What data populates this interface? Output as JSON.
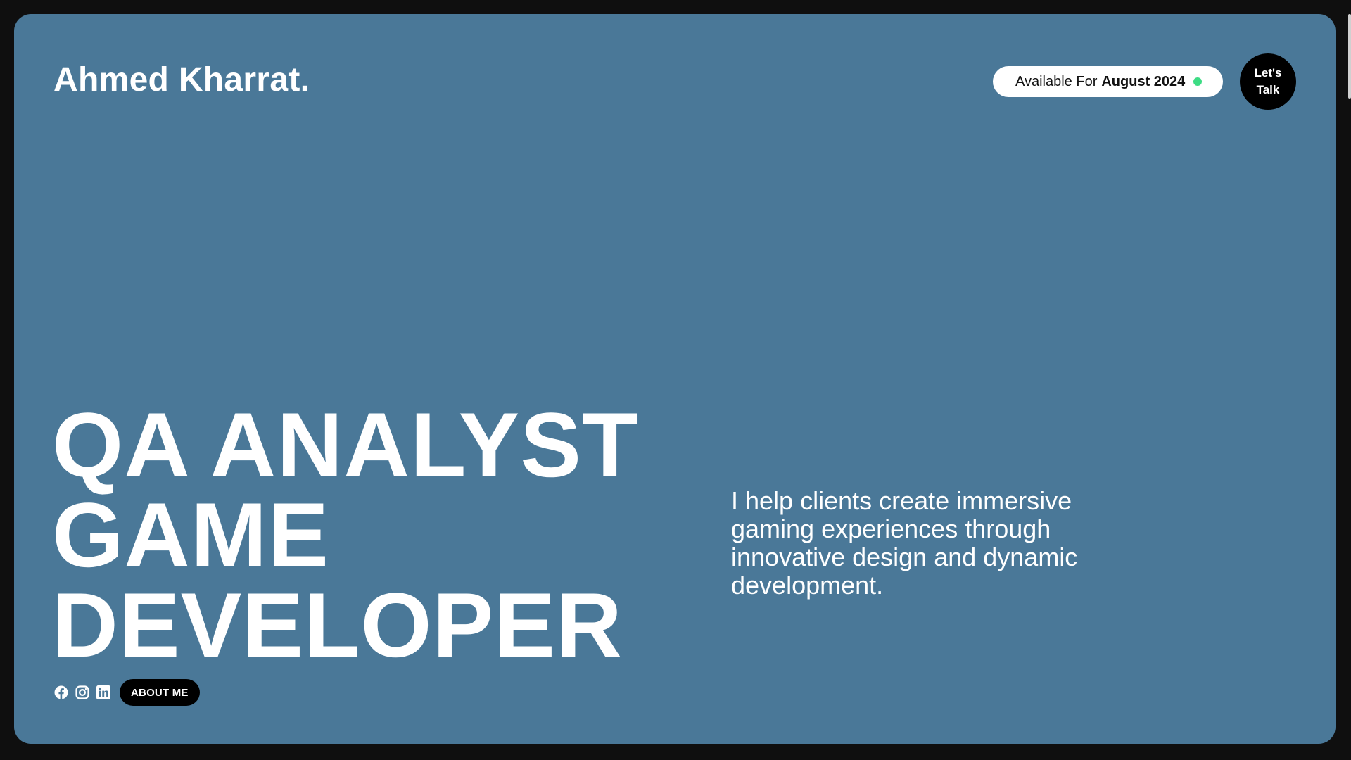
{
  "header": {
    "brand": "Ahmed Kharrat.",
    "availability": {
      "prefix": "Available For",
      "date": "August 2024",
      "status_color": "#3ddc84"
    },
    "cta": {
      "line1": "Let's",
      "line2": "Talk"
    }
  },
  "hero": {
    "headline_lines": [
      "QA ANALYST",
      "GAME",
      "DEVELOPER"
    ],
    "tagline": "I help clients create immersive gaming experiences through innovative design and dynamic development."
  },
  "footer": {
    "social_icons": [
      "facebook-icon",
      "instagram-icon",
      "linkedin-icon"
    ],
    "about_button": "ABOUT ME"
  },
  "colors": {
    "background": "#0f0f0f",
    "card": "#4a7898",
    "text": "#ffffff",
    "button": "#000000"
  }
}
